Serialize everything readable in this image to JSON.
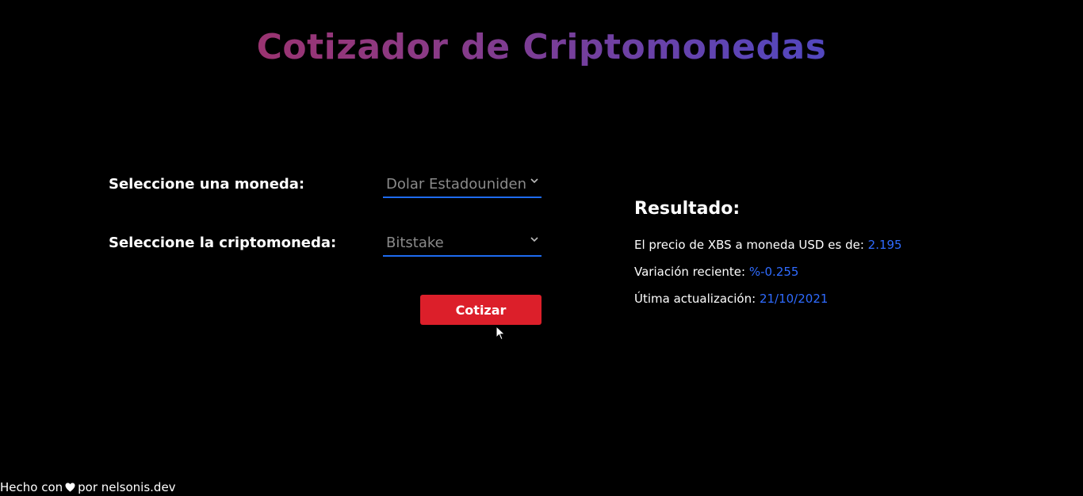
{
  "header": {
    "title": "Cotizador de Criptomonedas"
  },
  "form": {
    "currency_label": "Seleccione una moneda:",
    "currency_value": "Dolar Estadounidense",
    "crypto_label": "Seleccione la criptomoneda:",
    "crypto_value": "Bitstake",
    "submit_label": "Cotizar"
  },
  "result": {
    "heading": "Resultado:",
    "price_label": "El precio de XBS a moneda USD es de:",
    "price_value": "2.195",
    "change_label": "Variación reciente:",
    "change_value": "%-0.255",
    "updated_label": "Útima actualización:",
    "updated_value": "21/10/2021"
  },
  "footer": {
    "text_before": "Hecho con",
    "heart_icon": "heart-icon",
    "text_after": "por nelsonis.dev"
  },
  "colors": {
    "background": "#000000",
    "accent_blue": "#2f6bff",
    "button_red": "#dc1f2a"
  }
}
